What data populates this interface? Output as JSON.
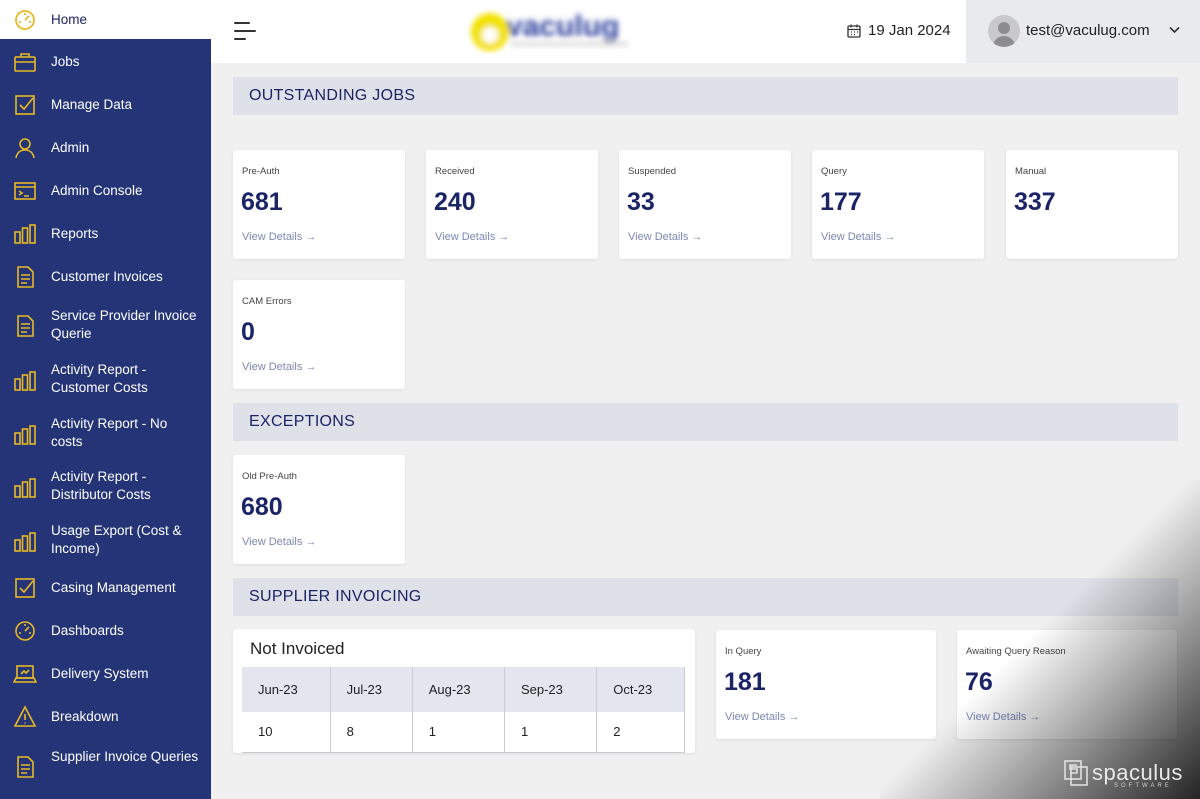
{
  "colors": {
    "sidebar": "#243476",
    "accent": "#e8b923",
    "text_primary": "#1b2466",
    "link": "#7b88b5"
  },
  "sidebar": {
    "items": [
      {
        "label": "Home",
        "icon": "speedometer-icon"
      },
      {
        "label": "Jobs",
        "icon": "briefcase-icon"
      },
      {
        "label": "Manage Data",
        "icon": "checkbox-icon"
      },
      {
        "label": "Admin",
        "icon": "user-icon"
      },
      {
        "label": "Admin Console",
        "icon": "terminal-icon"
      },
      {
        "label": "Reports",
        "icon": "bar-chart-icon"
      },
      {
        "label": "Customer Invoices",
        "icon": "document-icon"
      },
      {
        "label": "Service Provider Invoice Querie",
        "icon": "document-icon"
      },
      {
        "label": "Activity Report - Customer Costs",
        "icon": "bar-chart-icon"
      },
      {
        "label": "Activity Report - No costs",
        "icon": "bar-chart-icon"
      },
      {
        "label": "Activity Report - Distributor Costs",
        "icon": "bar-chart-icon"
      },
      {
        "label": "Usage Export (Cost & Income)",
        "icon": "bar-chart-icon"
      },
      {
        "label": "Casing Management",
        "icon": "checkbox-icon"
      },
      {
        "label": "Dashboards",
        "icon": "speedometer-icon"
      },
      {
        "label": "Delivery System",
        "icon": "laptop-icon"
      },
      {
        "label": "Breakdown",
        "icon": "warning-icon"
      },
      {
        "label": "Supplier Invoice Queries",
        "icon": "document-icon"
      }
    ]
  },
  "header": {
    "menu_icon": "hamburger-menu-icon",
    "date": "19 Jan 2024",
    "user_email": "test@vaculug.com"
  },
  "outstanding": {
    "title": "OUTSTANDING JOBS",
    "cards": [
      {
        "label": "Pre-Auth",
        "value": "681",
        "link": "View Details →"
      },
      {
        "label": "Received",
        "value": "240",
        "link": "View Details →"
      },
      {
        "label": "Suspended",
        "value": "33",
        "link": "View Details →"
      },
      {
        "label": "Query",
        "value": "177",
        "link": "View Details →"
      },
      {
        "label": "Manual",
        "value": "337"
      },
      {
        "label": "CAM Errors",
        "value": "0",
        "link": "View Details →"
      }
    ]
  },
  "exceptions": {
    "title": "EXCEPTIONS",
    "cards": [
      {
        "label": "Old Pre-Auth",
        "value": "680",
        "link": "View Details →"
      }
    ]
  },
  "supplier": {
    "title": "SUPPLIER INVOICING",
    "not_invoiced": {
      "title": "Not Invoiced",
      "headers": [
        "Jun-23",
        "Jul-23",
        "Aug-23",
        "Sep-23",
        "Oct-23"
      ],
      "values": [
        "10",
        "8",
        "1",
        "1",
        "2"
      ]
    },
    "cards": [
      {
        "label": "In Query",
        "value": "181",
        "link": "View Details →"
      },
      {
        "label": "Awaiting Query Reason",
        "value": "76",
        "link": "View Details →"
      }
    ]
  },
  "watermark": {
    "text": "spaculus",
    "sub": "SOFTWARE"
  }
}
